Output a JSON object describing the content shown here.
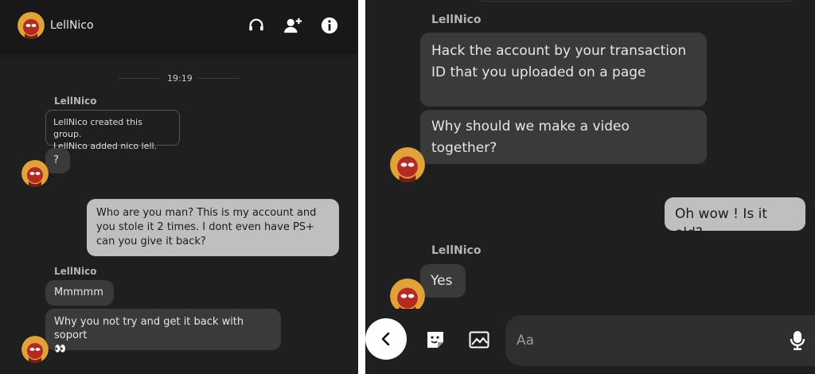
{
  "left": {
    "header": {
      "title": "LellNico",
      "icons": [
        "headset-icon",
        "add-friend-icon",
        "info-icon"
      ]
    },
    "timestamp": "19:19",
    "messages": {
      "sender1": "LellNico",
      "system": "LellNico created this group.\nLellNico added nico lell.",
      "question": "?",
      "outgoing": "Who are you man? This is my account and you stole it 2 times. I dont even have PS+ can you give it back?",
      "sender2": "LellNico",
      "mmmmm": "Mmmmm",
      "why_not": "Why you not try and get it back with soport",
      "emoji": "👀"
    }
  },
  "right": {
    "sender1": "LellNico",
    "msg1": "Hack the account by your transaction ID that you uploaded on a page",
    "msg2": "Why should we make a video together?",
    "outgoing": "Oh wow ! Is it old?",
    "sender2": "LellNico",
    "msg3": "Yes",
    "composer": {
      "placeholder": "Aa",
      "icons": [
        "back-icon",
        "sticker-icon",
        "image-icon",
        "microphone-icon"
      ]
    }
  },
  "colors": {
    "background": "#1f1f1f",
    "header": "#181818",
    "incoming_bubble": "#3a3a3a",
    "outgoing_bubble": "#bfbfbf",
    "divider": "#ffffff"
  }
}
